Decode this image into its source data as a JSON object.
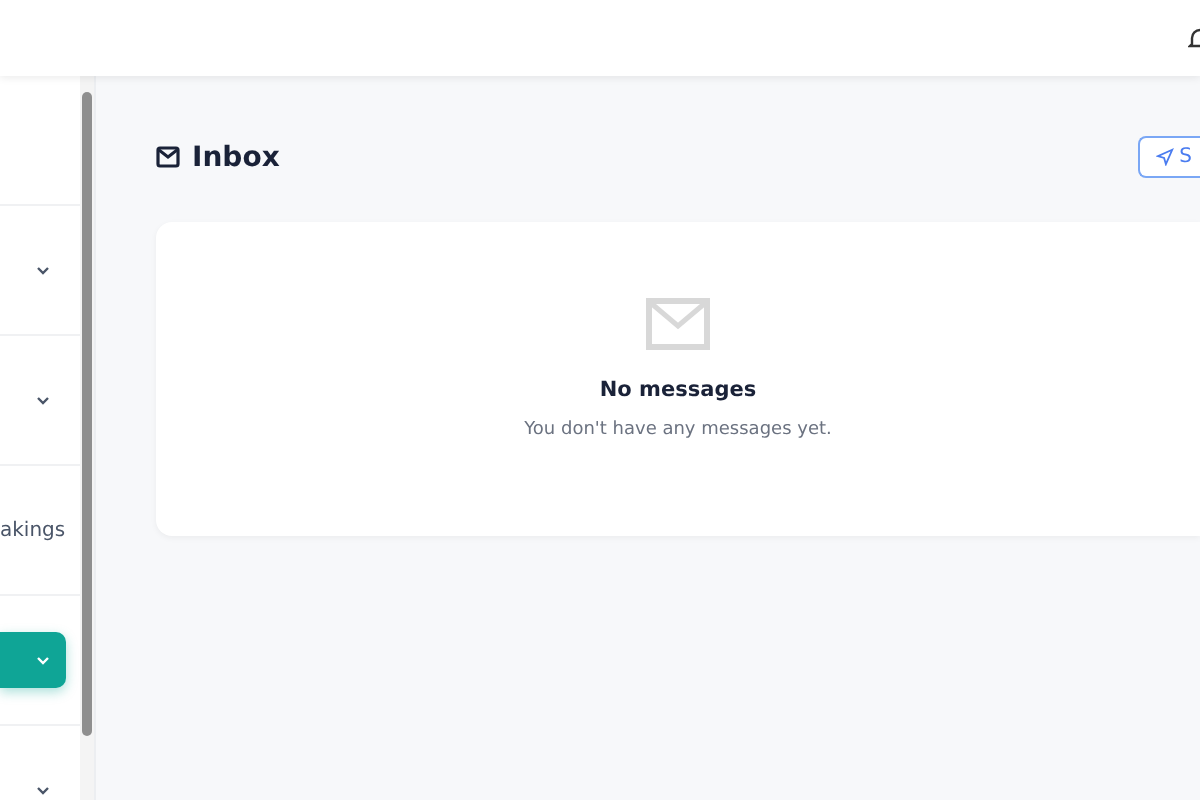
{
  "sidebar": {
    "items": [
      {
        "expandable": false,
        "selected": false
      },
      {
        "expandable": true,
        "selected": false
      },
      {
        "expandable": true,
        "selected": false
      },
      {
        "label": "akings",
        "expandable": false,
        "selected": false
      },
      {
        "expandable": true,
        "selected": true
      },
      {
        "expandable": true,
        "selected": false
      }
    ]
  },
  "page": {
    "title": "Inbox",
    "action_button": "S"
  },
  "empty_state": {
    "title": "No messages",
    "message": "You don't have any messages yet."
  }
}
